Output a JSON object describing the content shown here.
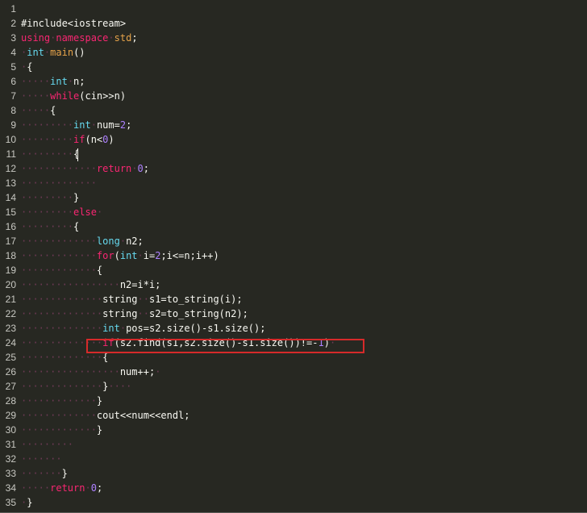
{
  "editor": {
    "colors": {
      "background": "#272822",
      "text": "#f8f8f2",
      "keyword": "#f92672",
      "type": "#66d9ef",
      "number": "#ae81ff",
      "function": "#e6a34a",
      "whitespace_marker": "#6e3a55",
      "highlight_box": "#d62a2a"
    },
    "lines": [
      {
        "num": "1",
        "tokens": []
      },
      {
        "num": "2",
        "tokens": [
          [
            "plain",
            "#include<iostream>"
          ]
        ]
      },
      {
        "num": "3",
        "tokens": [
          [
            "kw",
            "using"
          ],
          [
            "ws",
            "·"
          ],
          [
            "kw",
            "namespace"
          ],
          [
            "ws",
            "·"
          ],
          [
            "fn",
            "std"
          ],
          [
            "plain",
            ";"
          ]
        ]
      },
      {
        "num": "4",
        "tokens": [
          [
            "ws",
            "·"
          ],
          [
            "type",
            "int"
          ],
          [
            "ws",
            "·"
          ],
          [
            "fn",
            "main"
          ],
          [
            "plain",
            "()"
          ]
        ]
      },
      {
        "num": "5",
        "tokens": [
          [
            "ws",
            "·"
          ],
          [
            "plain",
            "{"
          ]
        ]
      },
      {
        "num": "6",
        "tokens": [
          [
            "ws",
            "·····"
          ],
          [
            "type",
            "int"
          ],
          [
            "ws",
            "·"
          ],
          [
            "plain",
            "n;"
          ]
        ]
      },
      {
        "num": "7",
        "tokens": [
          [
            "ws",
            "·····"
          ],
          [
            "kw",
            "while"
          ],
          [
            "plain",
            "(cin>>n)"
          ]
        ]
      },
      {
        "num": "8",
        "tokens": [
          [
            "ws",
            "·····"
          ],
          [
            "plain",
            "{"
          ]
        ]
      },
      {
        "num": "9",
        "tokens": [
          [
            "ws",
            "·········"
          ],
          [
            "type",
            "int"
          ],
          [
            "ws",
            "·"
          ],
          [
            "plain",
            "num="
          ],
          [
            "num",
            "2"
          ],
          [
            "plain",
            ";"
          ]
        ]
      },
      {
        "num": "10",
        "tokens": [
          [
            "ws",
            "·········"
          ],
          [
            "kw",
            "if"
          ],
          [
            "plain",
            "(n<"
          ],
          [
            "num",
            "0"
          ],
          [
            "plain",
            ")"
          ]
        ]
      },
      {
        "num": "11",
        "tokens": [
          [
            "ws",
            "·········"
          ],
          [
            "plain",
            "{"
          ]
        ]
      },
      {
        "num": "12",
        "tokens": [
          [
            "ws",
            "·············"
          ],
          [
            "kw",
            "return"
          ],
          [
            "ws",
            "·"
          ],
          [
            "num",
            "0"
          ],
          [
            "plain",
            ";"
          ]
        ]
      },
      {
        "num": "13",
        "tokens": [
          [
            "ws",
            "·············"
          ]
        ]
      },
      {
        "num": "14",
        "tokens": [
          [
            "ws",
            "·········"
          ],
          [
            "plain",
            "}"
          ]
        ]
      },
      {
        "num": "15",
        "tokens": [
          [
            "ws",
            "·········"
          ],
          [
            "kw",
            "else"
          ],
          [
            "ws",
            "·"
          ]
        ]
      },
      {
        "num": "16",
        "tokens": [
          [
            "ws",
            "·········"
          ],
          [
            "plain",
            "{"
          ]
        ]
      },
      {
        "num": "17",
        "tokens": [
          [
            "ws",
            "·············"
          ],
          [
            "type",
            "long"
          ],
          [
            "ws",
            "·"
          ],
          [
            "plain",
            "n2;"
          ]
        ]
      },
      {
        "num": "18",
        "tokens": [
          [
            "ws",
            "·············"
          ],
          [
            "kw",
            "for"
          ],
          [
            "plain",
            "("
          ],
          [
            "type",
            "int"
          ],
          [
            "ws",
            "·"
          ],
          [
            "plain",
            "i="
          ],
          [
            "num",
            "2"
          ],
          [
            "plain",
            ";i<=n;i++)"
          ]
        ]
      },
      {
        "num": "19",
        "tokens": [
          [
            "ws",
            "·············"
          ],
          [
            "plain",
            "{"
          ]
        ]
      },
      {
        "num": "20",
        "tokens": [
          [
            "ws",
            "·················"
          ],
          [
            "plain",
            "n2=i*i;"
          ]
        ]
      },
      {
        "num": "21",
        "tokens": [
          [
            "ws",
            "··············"
          ],
          [
            "plain",
            "string"
          ],
          [
            "ws",
            "··"
          ],
          [
            "plain",
            "s1=to_string(i);"
          ]
        ]
      },
      {
        "num": "22",
        "tokens": [
          [
            "ws",
            "··············"
          ],
          [
            "plain",
            "string"
          ],
          [
            "ws",
            "··"
          ],
          [
            "plain",
            "s2=to_string(n2);"
          ]
        ]
      },
      {
        "num": "23",
        "tokens": [
          [
            "ws",
            "··············"
          ],
          [
            "type",
            "int"
          ],
          [
            "ws",
            "·"
          ],
          [
            "plain",
            "pos=s2.size()-s1.size();"
          ]
        ]
      },
      {
        "num": "24",
        "tokens": [
          [
            "ws",
            "··············"
          ],
          [
            "kw",
            "if"
          ],
          [
            "plain",
            "(s2.find(s1,s2.size()-s1.size())!=-"
          ],
          [
            "num",
            "1"
          ],
          [
            "plain",
            ")"
          ],
          [
            "ws",
            "·"
          ]
        ]
      },
      {
        "num": "25",
        "tokens": [
          [
            "ws",
            "··············"
          ],
          [
            "plain",
            "{"
          ]
        ]
      },
      {
        "num": "26",
        "tokens": [
          [
            "ws",
            "·················"
          ],
          [
            "plain",
            "num++;"
          ],
          [
            "ws",
            "·"
          ]
        ]
      },
      {
        "num": "27",
        "tokens": [
          [
            "ws",
            "··············"
          ],
          [
            "plain",
            "}"
          ],
          [
            "ws",
            "····"
          ]
        ]
      },
      {
        "num": "28",
        "tokens": [
          [
            "ws",
            "·············"
          ],
          [
            "plain",
            "}"
          ]
        ]
      },
      {
        "num": "29",
        "tokens": [
          [
            "ws",
            "·············"
          ],
          [
            "plain",
            "cout<<num<<endl;"
          ]
        ]
      },
      {
        "num": "30",
        "tokens": [
          [
            "ws",
            "·············"
          ],
          [
            "plain",
            "}"
          ]
        ]
      },
      {
        "num": "31",
        "tokens": [
          [
            "ws",
            "·········"
          ]
        ]
      },
      {
        "num": "32",
        "tokens": [
          [
            "ws",
            "·······"
          ]
        ]
      },
      {
        "num": "33",
        "tokens": [
          [
            "ws",
            "·······"
          ],
          [
            "plain",
            "}"
          ]
        ]
      },
      {
        "num": "34",
        "tokens": [
          [
            "ws",
            "·····"
          ],
          [
            "kw",
            "return"
          ],
          [
            "ws",
            "·"
          ],
          [
            "num",
            "0"
          ],
          [
            "plain",
            ";"
          ]
        ]
      },
      {
        "num": "35",
        "tokens": [
          [
            "ws",
            "·"
          ],
          [
            "plain",
            "}"
          ]
        ]
      }
    ]
  }
}
